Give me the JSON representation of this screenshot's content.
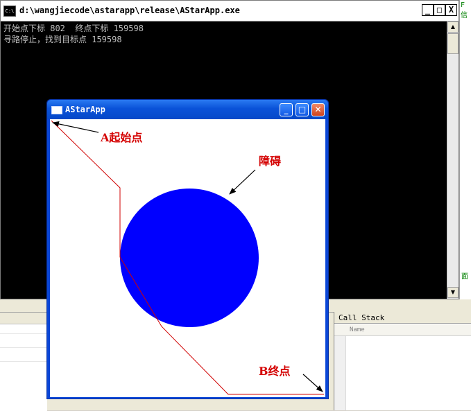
{
  "console": {
    "title": "d:\\wangjiecode\\astarapp\\release\\AStarApp.exe",
    "icon": "C:\\",
    "minimize_label": "_",
    "maximize_label": "□",
    "close_label": "X",
    "lines": [
      "开始点下标 802  终点下标 159598",
      "寻路停止，找到目标点 159598"
    ],
    "scroll_up_label": "▲",
    "scroll_down_label": "▼"
  },
  "ide": {
    "right_text_top": "F信",
    "right_text_bottom": "面",
    "call_stack": {
      "title": "Call Stack",
      "col_name": "Name"
    }
  },
  "app": {
    "title": "AStarApp",
    "minimize_label": "_",
    "maximize_label": "□",
    "close_label": "✕",
    "annotations": {
      "start": "A起始点",
      "obstacle": "障碍",
      "end": "B终点"
    },
    "colors": {
      "obstacle": "#0000ff",
      "path": "#d00000",
      "arrow": "#000000",
      "label": "#d40000"
    }
  }
}
